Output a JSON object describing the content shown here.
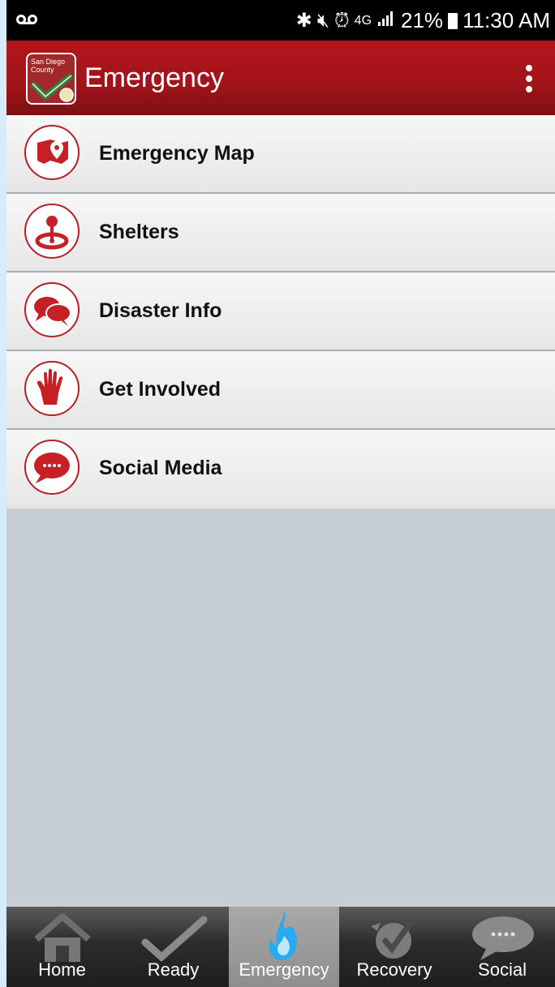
{
  "status_bar": {
    "voicemail_icon": "voicemail-icon",
    "network": "4G",
    "battery": "21%",
    "time": "11:30 AM"
  },
  "app_bar": {
    "logo_text_line1": "San Diego",
    "logo_text_line2": "County",
    "title": "Emergency",
    "overflow_icon": "more-vert-icon"
  },
  "menu": {
    "items": [
      {
        "label": "Emergency Map",
        "icon": "map-pin-icon"
      },
      {
        "label": "Shelters",
        "icon": "shelter-location-icon"
      },
      {
        "label": "Disaster Info",
        "icon": "chat-bubbles-icon"
      },
      {
        "label": "Get Involved",
        "icon": "hand-icon"
      },
      {
        "label": "Social Media",
        "icon": "speech-bubble-icon"
      }
    ]
  },
  "bottom_nav": {
    "items": [
      {
        "label": "Home",
        "icon": "home-icon",
        "active": false
      },
      {
        "label": "Ready",
        "icon": "checkmark-icon",
        "active": false
      },
      {
        "label": "Emergency",
        "icon": "flame-icon",
        "active": true
      },
      {
        "label": "Recovery",
        "icon": "recovery-icon",
        "active": false
      },
      {
        "label": "Social",
        "icon": "speech-bubble-icon",
        "active": false
      }
    ]
  },
  "colors": {
    "brand_red": "#b3161c",
    "active_blue": "#29a9f0",
    "background": "#c7ced6"
  }
}
